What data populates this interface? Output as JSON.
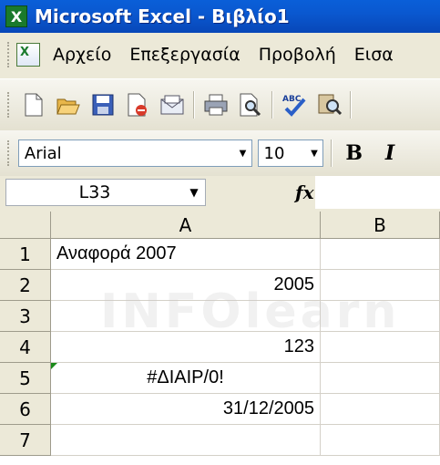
{
  "window": {
    "title": "Microsoft Excel - Βιβλίο1",
    "app_icon": "X"
  },
  "menu": {
    "items": [
      "Αρχείο",
      "Επεξεργασία",
      "Προβολή",
      "Εισα"
    ]
  },
  "toolbar": {
    "icons": [
      "new-icon",
      "open-icon",
      "save-icon",
      "permission-icon",
      "email-icon",
      "print-icon",
      "print-preview-icon",
      "spelling-icon",
      "research-icon"
    ]
  },
  "format": {
    "font": "Arial",
    "size": "10",
    "bold": "B",
    "italic": "I"
  },
  "formula": {
    "name_box": "L33",
    "fx": "fx",
    "content": ""
  },
  "sheet": {
    "columns": [
      "A",
      "B"
    ],
    "rows": [
      {
        "num": "1",
        "a": "Αναφορά 2007",
        "b": ""
      },
      {
        "num": "2",
        "a": "2005",
        "b": ""
      },
      {
        "num": "3",
        "a": "",
        "b": ""
      },
      {
        "num": "4",
        "a": "123",
        "b": ""
      },
      {
        "num": "5",
        "a": "#ΔΙΑΙΡ/0!",
        "b": ""
      },
      {
        "num": "6",
        "a": "31/12/2005",
        "b": ""
      },
      {
        "num": "7",
        "a": "",
        "b": ""
      }
    ]
  },
  "watermark": "INFOlearn"
}
